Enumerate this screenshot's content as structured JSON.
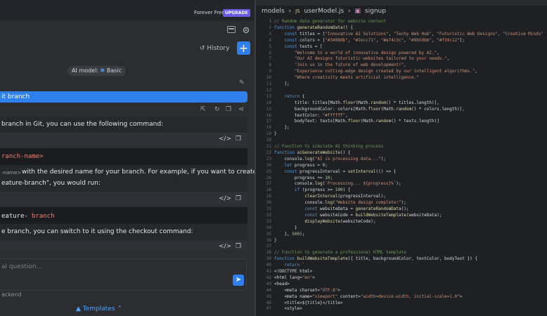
{
  "left": {
    "forever_free": "Forever Free",
    "upgrade": "UPGRADE",
    "history": "History",
    "plus": "+",
    "ai_model_label": "AI model:",
    "ai_model_value": "Basic",
    "user_message": "it branch",
    "answer": {
      "line1": "branch in Git, you can use the following command:",
      "code1": "ranch-name>",
      "line2_small": "-name>",
      "line2": "with the desired name for your branch. For example, if you want to create a",
      "line3": "eature-branch\", you would run:",
      "code2a": "eature-",
      "code2b": "branch",
      "line4": "e branch, you can switch to it using the checkout command:"
    },
    "input_placeholder": "al question...",
    "backend": "ackend",
    "templates": "Templates"
  },
  "right": {
    "breadcrumb": [
      "models",
      "userModel.js",
      "signup"
    ],
    "line_numbers": [
      "1",
      "2",
      "3",
      "4",
      "5",
      "6",
      "7",
      "8",
      "9",
      "10",
      "11",
      "12",
      "13",
      "14",
      "15",
      "16",
      "17",
      "18",
      "19",
      "20",
      "21",
      "22",
      "23",
      "24",
      "25",
      "26",
      "27",
      "28",
      "29",
      "30",
      "31",
      "32",
      "33",
      "34",
      "35",
      "36",
      "37",
      "38",
      "39",
      "40",
      "41",
      "42",
      "43",
      "44",
      "45",
      "46",
      "47"
    ],
    "code_lines": [
      "// Random data generator for website content",
      "function generateRandomData() {",
      "    const titles = [\"Innovative AI Solutions\", \"Techy Web Hub\", \"Futuristic Web Designs\", \"Creative Minds\"",
      "    const colors = [\"#3498db\", \"#2ecc71\", \"#e74c3c\", \"#9b59b6\", \"#f39c12\"];",
      "    const texts = [",
      "        \"Welcome to a world of innovative design powered by AI.\",",
      "        \"Our AI designs futuristic websites tailored to your needs.\",",
      "        \"Join us in the future of web development!\",",
      "        \"Experience cutting-edge design created by our intelligent algorithms.\",",
      "        \"Where creativity meets artificial intelligence.\"",
      "    ];",
      "",
      "    return {",
      "        title: titles[Math.floor(Math.random() * titles.length)],",
      "        backgroundColor: colors[Math.floor(Math.random() * colors.length)],",
      "        textColor: \"#ffffff\",",
      "        bodyText: texts[Math.floor(Math.random() * texts.length)]",
      "    };",
      "}",
      "",
      "// Function to simulate AI thinking process",
      "function aiGenerateWebsite() {",
      "    console.log(\"AI is processing data...\");",
      "    let progress = 0;",
      "    const progressInterval = setInterval(() => {",
      "        progress += 10;",
      "        console.log(`Processing... ${progress}%`);",
      "        if (progress >= 100) {",
      "            clearInterval(progressInterval);",
      "            console.log(\"Website design complete!\");",
      "            const websiteData = generateRandomData();",
      "            const websiteCode = buildWebsiteTemplate(websiteData);",
      "            displayWebsite(websiteCode);",
      "        }",
      "    }, 500);",
      "}",
      "",
      "// Function to generate a professional HTML template",
      "function buildWebsiteTemplate({ title, backgroundColor, textColor, bodyText }) {",
      "    return `",
      "<!DOCTYPE html>",
      "<html lang=\"en\">",
      "<head>",
      "    <meta charset=\"UTF-8\">",
      "    <meta name=\"viewport\" content=\"width=device-width, initial-scale=1.0\">",
      "    <title>${title}</title>",
      "    <style>"
    ]
  }
}
